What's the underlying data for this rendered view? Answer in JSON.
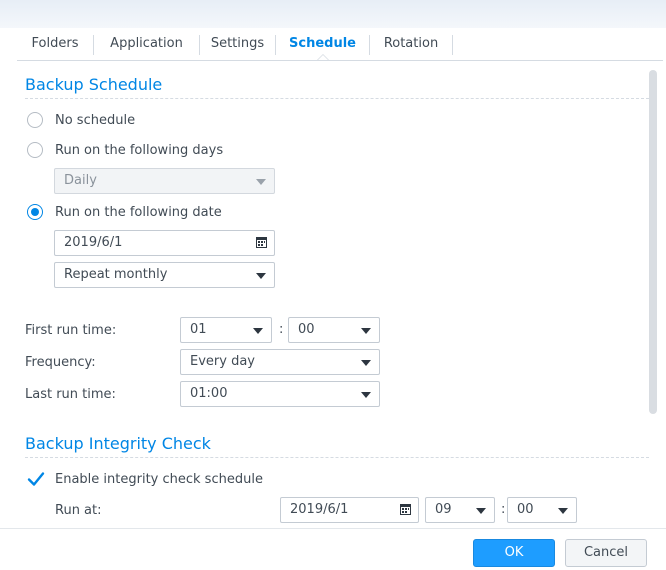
{
  "tabs": [
    {
      "label": "Folders"
    },
    {
      "label": "Application"
    },
    {
      "label": "Settings"
    },
    {
      "label": "Schedule",
      "active": true
    },
    {
      "label": "Rotation"
    }
  ],
  "backup_schedule": {
    "title": "Backup Schedule",
    "options": [
      {
        "label": "No schedule",
        "checked": false
      },
      {
        "label": "Run on the following days",
        "checked": false
      },
      {
        "label": "Run on the following date",
        "checked": true
      }
    ],
    "days_select": {
      "value": "Daily",
      "disabled": true
    },
    "date_field": {
      "value": "2019/6/1"
    },
    "repeat_select": {
      "value": "Repeat monthly"
    },
    "first_run_time": {
      "label": "First run time:",
      "hour": "01",
      "separator": ":",
      "minute": "00"
    },
    "frequency": {
      "label": "Frequency:",
      "value": "Every day"
    },
    "last_run_time": {
      "label": "Last run time:",
      "value": "01:00"
    }
  },
  "integrity_check": {
    "title": "Backup Integrity Check",
    "enable_label": "Enable integrity check schedule",
    "enabled": true,
    "run_at": {
      "label": "Run at:",
      "date": "2019/6/1",
      "hour": "09",
      "separator": ":",
      "minute": "00"
    }
  },
  "footer": {
    "ok_label": "OK",
    "cancel_label": "Cancel"
  },
  "colors": {
    "accent": "#0086e5",
    "primary_button": "#1e9dff"
  }
}
